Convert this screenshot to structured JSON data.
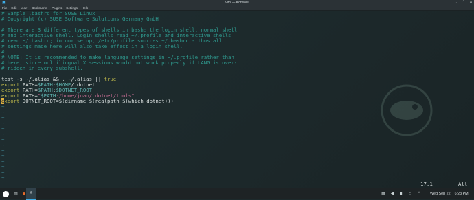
{
  "window": {
    "title": "vim — Konsole"
  },
  "menubar": {
    "items": [
      "File",
      "Edit",
      "View",
      "Bookmarks",
      "Plugins",
      "Settings",
      "Help"
    ]
  },
  "editor": {
    "lines": [
      "# Sample .bashrc for SUSE Linux",
      "# Copyright (c) SUSE Software Solutions Germany GmbH",
      "",
      "# There are 3 different types of shells in bash: the login shell, normal shell",
      "# and interactive shell. Login shells read ~/.profile and interactive shells",
      "# read ~/.bashrc; in our setup, /etc/profile sources ~/.bashrc - thus all",
      "# settings made here will also take effect in a login shell.",
      "#",
      "# NOTE: It is recommended to make language settings in ~/.profile rather than",
      "# here, since multilingual X sessions would not work properly if LANG is over-",
      "# ridden in every subshell.",
      "",
      "test -s ~/.alias && . ~/.alias || true",
      "export PATH=$PATH:$HOME/.dotnet",
      "export PATH=$PATH:$DOTNET_ROOT",
      "export PATH=\"$PATH:/home/joao/.dotnet/tools\"",
      "export DOTNET_ROOT=$(dirname $(realpath $(which dotnet)))"
    ],
    "segments": {
      "l12": {
        "a": "test -s ~/.alias && . ~/.alias || ",
        "b": "true"
      },
      "l13": {
        "kw": "export",
        "a": " PATH=",
        "v1": "$PATH",
        "b": ":",
        "v2": "$HOME",
        "c": "/.dotnet"
      },
      "l14": {
        "kw": "export",
        "a": " PATH=",
        "v1": "$PATH",
        "b": ":",
        "v2": "$DOTNET_ROOT"
      },
      "l15": {
        "kw": "export",
        "a": " PATH=",
        "s1": "\"",
        "v1": "$PATH",
        "s2": ":/home/joao/.dotnet/tools\""
      },
      "l16": {
        "cursor": "e",
        "kw": "xport",
        "a": " DOTNET_ROOT=",
        "v1": "$(dirname $(realpath $(which dotnet)))"
      }
    },
    "tilde": "~"
  },
  "status": {
    "position": "17,1",
    "scroll": "All"
  },
  "taskbar": {
    "active_task": "K",
    "clock": {
      "date": "Wed Sep 22",
      "time": "6:23 PM"
    }
  },
  "colors": {
    "comment": "#2f9a8f",
    "keyword": "#b7b24a",
    "variable": "#5fb3b0",
    "string": "#c06a8f",
    "accent": "#3daee9"
  }
}
